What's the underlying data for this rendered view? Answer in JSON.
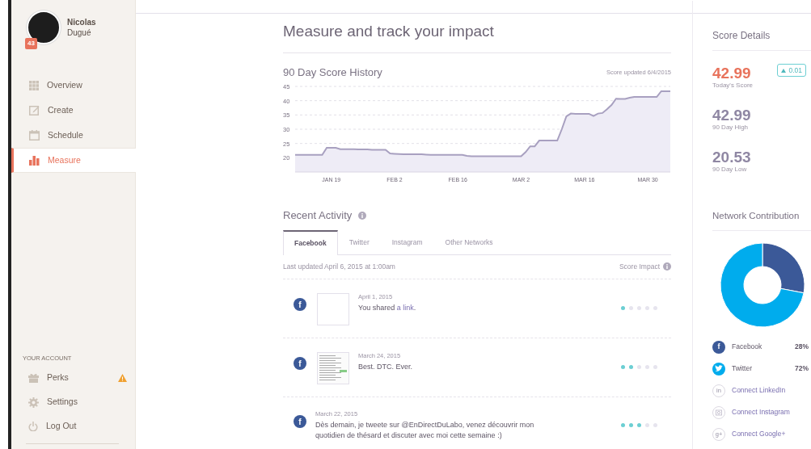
{
  "sidebar": {
    "user": {
      "first_name": "Nicolas",
      "last_name": "Dugué",
      "badge": "43"
    },
    "nav": [
      {
        "label": "Overview",
        "selected": false
      },
      {
        "label": "Create",
        "selected": false
      },
      {
        "label": "Schedule",
        "selected": false
      },
      {
        "label": "Measure",
        "selected": true
      }
    ],
    "account_heading": "YOUR ACCOUNT",
    "account": [
      {
        "label": "Perks",
        "warning": true
      },
      {
        "label": "Settings",
        "warning": false
      },
      {
        "label": "Log Out",
        "warning": false
      }
    ]
  },
  "page_title": "Measure and track your impact",
  "history": {
    "title": "90 Day Score History",
    "updated": "Score updated 6/4/2015",
    "chart_data": {
      "type": "area",
      "categories": [
        null,
        null,
        null,
        null,
        null,
        null,
        null,
        null,
        "JAN 19",
        null,
        null,
        null,
        null,
        null,
        null,
        null,
        null,
        null,
        null,
        null,
        null,
        null,
        "FEB 2",
        null,
        null,
        null,
        null,
        null,
        null,
        null,
        null,
        null,
        null,
        null,
        null,
        null,
        "FEB 16",
        null,
        null,
        null,
        null,
        null,
        null,
        null,
        null,
        null,
        null,
        null,
        null,
        null,
        "MAR 2",
        null,
        null,
        null,
        null,
        null,
        null,
        null,
        null,
        null,
        null,
        null,
        null,
        null,
        "MAR 16",
        null,
        null,
        null,
        null,
        null,
        null,
        null,
        null,
        null,
        null,
        null,
        null,
        null,
        "MAR 30",
        null,
        null,
        null,
        null,
        null
      ],
      "values": [
        21,
        21,
        21,
        21,
        21,
        21,
        21,
        23.5,
        23.5,
        23.5,
        23,
        23,
        23,
        23,
        22.9,
        22.9,
        22.9,
        22.8,
        22.8,
        22.8,
        22.8,
        21.5,
        21.4,
        21.3,
        21.2,
        21.2,
        21.2,
        21.2,
        21.2,
        21.1,
        21,
        21,
        21,
        21,
        21,
        21,
        21,
        21,
        20.7,
        20.5,
        20.5,
        20.5,
        20.5,
        20.5,
        20.5,
        20.5,
        20.5,
        20.5,
        20.5,
        20.5,
        20.5,
        22,
        24,
        24,
        26,
        26,
        26,
        26,
        26,
        30,
        34.5,
        35.5,
        35.4,
        35.4,
        35.4,
        35.4,
        34.6,
        35.5,
        35.7,
        37,
        38.5,
        40.7,
        40.6,
        40.6,
        41,
        41.3,
        41.3,
        41.3,
        41.3,
        41.3,
        41.3,
        43.3,
        43.3,
        43.3
      ],
      "ylim": [
        15,
        45
      ],
      "grid": true,
      "yticks": [
        20,
        25,
        30,
        35,
        40,
        45
      ]
    }
  },
  "activity": {
    "title": "Recent Activity",
    "tabs": [
      {
        "label": "Facebook",
        "selected": true
      },
      {
        "label": "Twitter",
        "selected": false
      },
      {
        "label": "Instagram",
        "selected": false
      },
      {
        "label": "Other Networks",
        "selected": false
      }
    ],
    "last_updated": "Last updated April 6, 2015 at 1:00am",
    "impact_label": "Score Impact",
    "items": [
      {
        "kind": "blank",
        "glyph": "f",
        "date": "April 1, 2015",
        "text": "You shared ",
        "link": "a link",
        "text_after": ".",
        "stars": 1
      },
      {
        "kind": "screenshot",
        "glyph": "f",
        "date": "March 24, 2015",
        "text": "Best. DTC. Ever.",
        "stars": 2
      },
      {
        "kind": "text",
        "glyph": "f",
        "date": "March 22, 2015",
        "text": "Dès demain, je tweete sur @EnDirectDuLabo, venez découvrir mon quotidien de thésard et discuter avec moi cette semaine :)",
        "stars": 3
      }
    ]
  },
  "score_details": {
    "title": "Score Details",
    "scores": [
      {
        "kind": "today",
        "value": "42.99",
        "label": "Today's Score",
        "change": "0.01"
      },
      {
        "kind": "stat",
        "value": "42.99",
        "label": "90 Day High"
      },
      {
        "kind": "stat",
        "value": "20.53",
        "label": "90 Day Low"
      }
    ]
  },
  "network": {
    "title": "Network Contribution",
    "chart_data": {
      "type": "donut",
      "values": [
        28,
        72
      ]
    },
    "legend": [
      {
        "kind": "connected",
        "glyph": "f",
        "label": "Facebook",
        "percent": "28%",
        "color": "#3b5998"
      },
      {
        "kind": "connected",
        "label": "Twitter",
        "percent": "72%",
        "color": "#00aced"
      },
      {
        "kind": "connect",
        "glyph": "in",
        "label": "Connect LinkedIn"
      },
      {
        "kind": "connect",
        "label": "Connect Instagram"
      },
      {
        "kind": "connect",
        "glyph": "g+",
        "label": "Connect Google+"
      }
    ]
  }
}
